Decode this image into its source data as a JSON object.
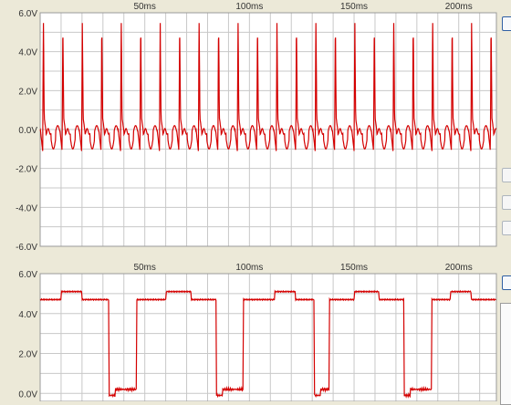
{
  "app_background": "#ece9d8",
  "trace_color": "#d40000",
  "grid_color": "#c8c8c8",
  "chart_data": [
    {
      "type": "line",
      "name_key": "top",
      "x_unit": "ms",
      "y_unit": "V",
      "xlim": [
        0,
        218
      ],
      "ylim": [
        -6,
        6
      ],
      "x_tick_labels": [
        "50ms",
        "100ms",
        "150ms",
        "200ms"
      ],
      "x_tick_values": [
        50,
        100,
        150,
        200
      ],
      "y_tick_labels": [
        "6.0V",
        "4.0V",
        "2.0V",
        "0.0V",
        "-2.0V",
        "-4.0V",
        "-6.0V"
      ],
      "y_tick_values": [
        6,
        4,
        2,
        0,
        -2,
        -4,
        -6
      ],
      "grid": true,
      "series": [
        {
          "waveform": "pulse-spikes",
          "period_ms": 9.3,
          "phase_ms": 1.2,
          "spike_peak_v": 5.6,
          "baseline_v": -0.1,
          "undershoot_v": -1.1
        }
      ]
    },
    {
      "type": "line",
      "name_key": "bottom",
      "x_unit": "ms",
      "y_unit": "V",
      "xlim": [
        0,
        218
      ],
      "ylim": [
        -0.4,
        6
      ],
      "x_tick_labels": [
        "50ms",
        "100ms",
        "150ms",
        "200ms"
      ],
      "x_tick_values": [
        50,
        100,
        150,
        200
      ],
      "y_tick_labels": [
        "6.0V",
        "4.0V",
        "2.0V",
        "0.0V"
      ],
      "y_tick_values": [
        6,
        4,
        2,
        0
      ],
      "grid": true,
      "series": [
        {
          "waveform": "square-with-steps",
          "high_v": 4.7,
          "step_high_v": 5.1,
          "low_v": -0.1,
          "low_step_v": 0.2,
          "low_intervals_ms": [
            [
              33,
              46
            ],
            [
              84,
              97
            ],
            [
              131,
              138
            ],
            [
              174,
              187
            ]
          ],
          "step_intervals_ms": [
            [
              10,
              20
            ],
            [
              60,
              72
            ],
            [
              112,
              122
            ],
            [
              150,
              162
            ],
            [
              196,
              206
            ]
          ]
        }
      ]
    }
  ]
}
